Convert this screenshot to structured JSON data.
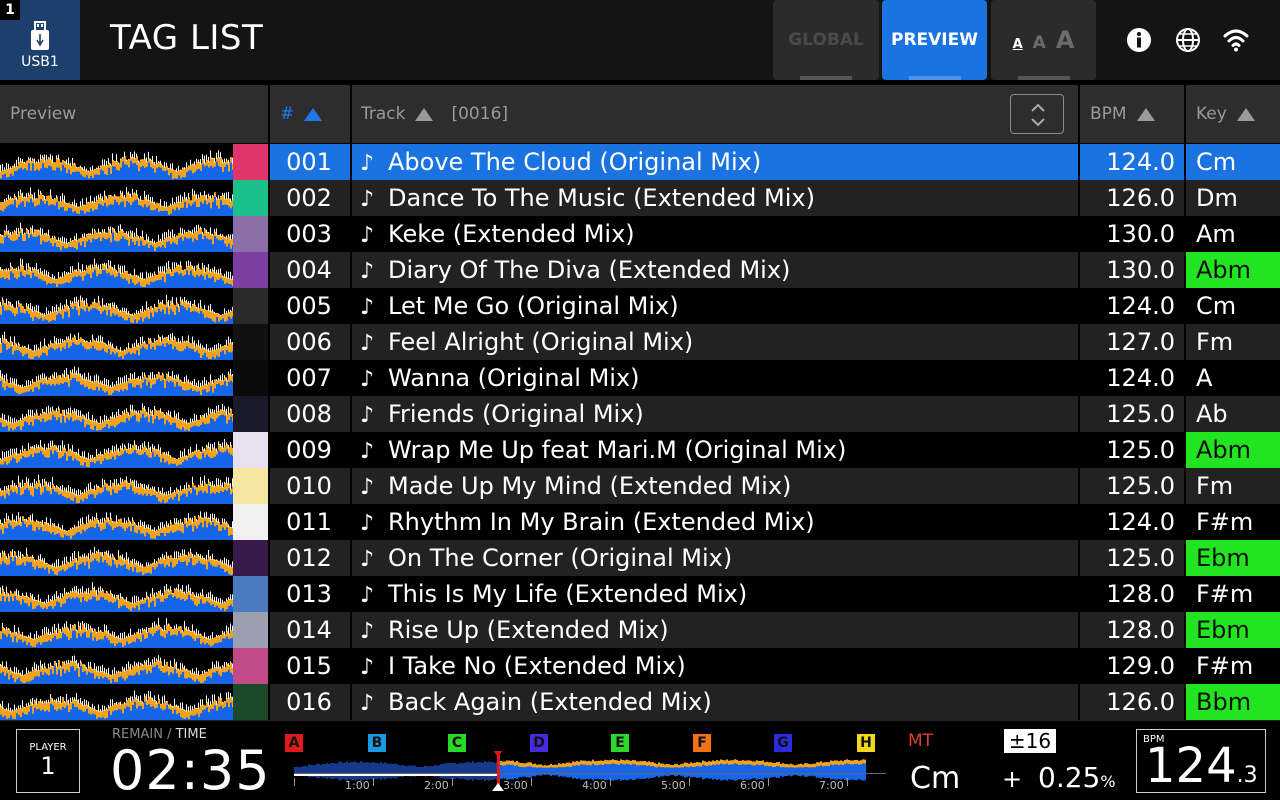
{
  "header": {
    "player_number": "1",
    "device_label": "USB1",
    "title": "TAG LIST",
    "tabs": [
      {
        "label": "GLOBAL",
        "active": false
      },
      {
        "label": "PREVIEW",
        "active": true
      }
    ],
    "font_size_glyphs": [
      "A",
      "A",
      "A"
    ]
  },
  "columns": {
    "preview": "Preview",
    "number": "#",
    "track": "Track",
    "track_count": "[0016]",
    "bpm": "BPM",
    "key": "Key"
  },
  "colors": {
    "accent": "#1a73e0",
    "key_highlight": "#21e521",
    "waveform_blue": "#1565e8",
    "waveform_orange": "#f2a21c",
    "mt": "#e23b2b"
  },
  "rows": [
    {
      "num": "001",
      "track": "Above The Cloud (Original Mix)",
      "bpm": "124.0",
      "key": "Cm",
      "highlight": false,
      "selected": true
    },
    {
      "num": "002",
      "track": "Dance To The Music (Extended Mix)",
      "bpm": "126.0",
      "key": "Dm",
      "highlight": false
    },
    {
      "num": "003",
      "track": "Keke (Extended Mix)",
      "bpm": "130.0",
      "key": "Am",
      "highlight": false
    },
    {
      "num": "004",
      "track": "Diary Of The Diva (Extended Mix)",
      "bpm": "130.0",
      "key": "Abm",
      "highlight": true
    },
    {
      "num": "005",
      "track": "Let Me Go (Original Mix)",
      "bpm": "124.0",
      "key": "Cm",
      "highlight": false
    },
    {
      "num": "006",
      "track": "Feel Alright (Original Mix)",
      "bpm": "127.0",
      "key": "Fm",
      "highlight": false
    },
    {
      "num": "007",
      "track": "Wanna (Original Mix)",
      "bpm": "124.0",
      "key": "A",
      "highlight": false
    },
    {
      "num": "008",
      "track": "Friends  (Original Mix)",
      "bpm": "125.0",
      "key": "Ab",
      "highlight": false
    },
    {
      "num": "009",
      "track": "Wrap Me Up feat Mari.M (Original Mix)",
      "bpm": "125.0",
      "key": "Abm",
      "highlight": true
    },
    {
      "num": "010",
      "track": "Made Up My Mind (Extended Mix)",
      "bpm": "125.0",
      "key": "Fm",
      "highlight": false
    },
    {
      "num": "011",
      "track": "Rhythm In My Brain (Extended Mix)",
      "bpm": "124.0",
      "key": "F#m",
      "highlight": false
    },
    {
      "num": "012",
      "track": "On The Corner (Original Mix)",
      "bpm": "125.0",
      "key": "Ebm",
      "highlight": true
    },
    {
      "num": "013",
      "track": "This Is My Life (Extended Mix)",
      "bpm": "128.0",
      "key": "F#m",
      "highlight": false
    },
    {
      "num": "014",
      "track": "Rise Up (Extended Mix)",
      "bpm": "128.0",
      "key": "Ebm",
      "highlight": true
    },
    {
      "num": "015",
      "track": "I Take No (Extended Mix)",
      "bpm": "129.0",
      "key": "F#m",
      "highlight": false
    },
    {
      "num": "016",
      "track": "Back Again (Extended Mix)",
      "bpm": "126.0",
      "key": "Bbm",
      "highlight": true
    }
  ],
  "art_colors": [
    "#e0356b",
    "#1bbf8a",
    "#8a6fa8",
    "#7a3fa0",
    "#2a2a2a",
    "#111111",
    "#0a0a0a",
    "#1a1a2a",
    "#e8e0f0",
    "#f5e6a0",
    "#f0f0f0",
    "#3a1a4a",
    "#4a7ac0",
    "#9aa0b0",
    "#c04a8a",
    "#1a4a2a"
  ],
  "footer": {
    "player_label": "PLAYER",
    "player_value": "1",
    "remain_label": "REMAIN",
    "time_label": "TIME",
    "time": "02:35",
    "hotcues": [
      {
        "label": "A",
        "color": "#e01a1a"
      },
      {
        "label": "B",
        "color": "#1a9ae0"
      },
      {
        "label": "C",
        "color": "#2ad82a"
      },
      {
        "label": "D",
        "color": "#4a2ae0"
      },
      {
        "label": "E",
        "color": "#2ad82a"
      },
      {
        "label": "F",
        "color": "#f0731a"
      },
      {
        "label": "G",
        "color": "#2a2ae0"
      },
      {
        "label": "H",
        "color": "#f0d81a"
      }
    ],
    "timeline": [
      "1:00",
      "2:00",
      "3:00",
      "4:00",
      "5:00",
      "6:00",
      "7:00"
    ],
    "mt_label": "MT",
    "key": "Cm",
    "tempo_range": "±16",
    "pitch_sign": "+",
    "pitch_value": "0.25",
    "pitch_unit": "%",
    "bpm_label": "BPM",
    "bpm_int": "124",
    "bpm_dec": ".3"
  }
}
